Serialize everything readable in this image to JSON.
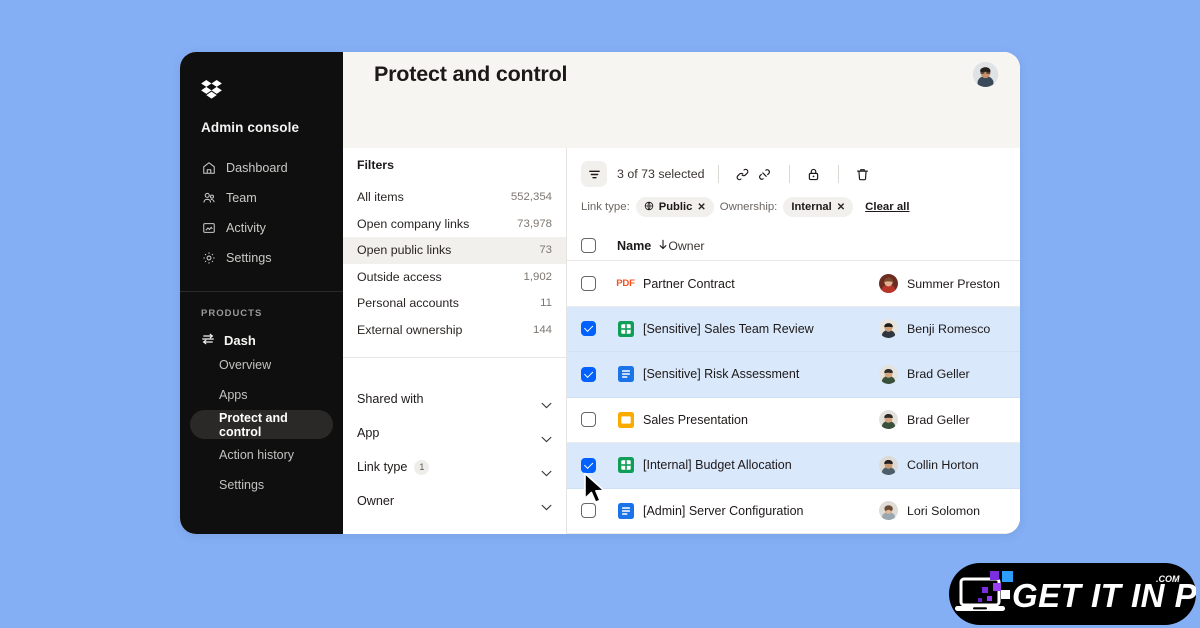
{
  "app": {
    "logo_icon": "dropbox-logo",
    "console_title": "Admin console"
  },
  "sidebar": {
    "nav": [
      {
        "label": "Dashboard",
        "icon": "home-icon"
      },
      {
        "label": "Team",
        "icon": "people-icon"
      },
      {
        "label": "Activity",
        "icon": "activity-icon"
      },
      {
        "label": "Settings",
        "icon": "gear-icon"
      }
    ],
    "products_label": "PRODUCTS",
    "product": {
      "label": "Dash",
      "icon": "dash-icon"
    },
    "product_items": [
      {
        "label": "Overview",
        "active": false
      },
      {
        "label": "Apps",
        "active": false
      },
      {
        "label": "Protect and control",
        "active": true
      },
      {
        "label": "Action history",
        "active": false
      },
      {
        "label": "Settings",
        "active": false
      }
    ]
  },
  "header": {
    "title": "Protect and control",
    "avatar_icon": "user-avatar"
  },
  "filters": {
    "title": "Filters",
    "items": [
      {
        "label": "All items",
        "count": "552,354",
        "selected": false
      },
      {
        "label": "Open company links",
        "count": "73,978",
        "selected": false
      },
      {
        "label": "Open public links",
        "count": "73",
        "selected": true
      },
      {
        "label": "Outside access",
        "count": "1,902",
        "selected": false
      },
      {
        "label": "Personal accounts",
        "count": "11",
        "selected": false
      },
      {
        "label": "External ownership",
        "count": "144",
        "selected": false
      }
    ],
    "accordions": [
      {
        "label": "Shared with",
        "badge": ""
      },
      {
        "label": "App",
        "badge": ""
      },
      {
        "label": "Link type",
        "badge": "1"
      },
      {
        "label": "Owner",
        "badge": ""
      }
    ]
  },
  "toolbar": {
    "filter_icon": "filter-icon",
    "selection_text": "3 of 73 selected",
    "actions": [
      {
        "icon": "link-icon",
        "name": "copy-link-button"
      },
      {
        "icon": "broken-link-icon",
        "name": "remove-link-button"
      },
      {
        "icon": "lock-icon",
        "name": "lock-button"
      },
      {
        "icon": "trash-icon",
        "name": "delete-button"
      }
    ],
    "link_type_label": "Link type:",
    "link_type_chip": "Public",
    "link_type_chip_icon": "globe-icon",
    "ownership_label": "Ownership:",
    "ownership_chip": "Internal",
    "clear_all": "Clear all"
  },
  "table": {
    "columns": {
      "name": "Name",
      "owner": "Owner",
      "sort_icon": "arrow-down-icon"
    },
    "rows": [
      {
        "checked": false,
        "filetype": "pdf",
        "name": "Partner Contract",
        "owner": "Summer Preston",
        "avatar": "#8a3b2e"
      },
      {
        "checked": true,
        "filetype": "sheet",
        "name": "[Sensitive] Sales Team Review",
        "owner": "Benji Romesco",
        "avatar": "#444c55"
      },
      {
        "checked": true,
        "filetype": "doc",
        "name": "[Sensitive] Risk Assessment",
        "owner": "Brad Geller",
        "avatar": "#3c4a3a"
      },
      {
        "checked": false,
        "filetype": "slide",
        "name": "Sales Presentation",
        "owner": "Brad Geller",
        "avatar": "#3c4a3a"
      },
      {
        "checked": true,
        "filetype": "sheet",
        "name": "[Internal] Budget Allocation",
        "owner": "Collin Horton",
        "avatar": "#57636b"
      },
      {
        "checked": false,
        "filetype": "doc",
        "name": "[Admin] Server Configuration",
        "owner": "Lori Solomon",
        "avatar": "#7b6a60"
      }
    ]
  },
  "cursor": {
    "icon": "mouse-pointer"
  },
  "watermark": {
    "text": "GET IT IN PC",
    "suffix": ".COM",
    "icon": "laptop-icon"
  },
  "colors": {
    "background": "#85aff5",
    "sidebar": "#0f0f0f",
    "accent": "#0061fe",
    "row_selected": "#d9e8fb",
    "topbar": "#f7f5f2",
    "pdf": "#f4511e",
    "sheet": "#0f9d58",
    "doc": "#1a73e8",
    "slide": "#f9ab00"
  }
}
